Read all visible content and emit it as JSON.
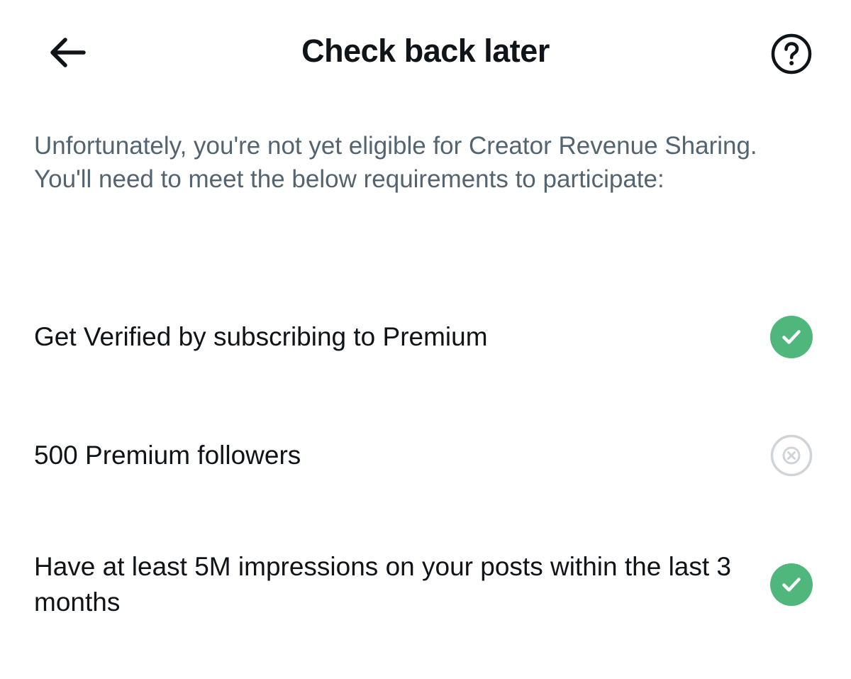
{
  "header": {
    "title": "Check back later",
    "back_icon": "arrow-left-icon",
    "help_icon": "question-circle-icon"
  },
  "intro": {
    "text": "Unfortunately, you're not yet eligible for Creator Revenue Sharing. You'll need to meet the below requirements to participate:"
  },
  "requirements": [
    {
      "label": "Get Verified by subscribing to Premium",
      "status": "met",
      "icon": "check-circle-icon"
    },
    {
      "label": "500 Premium followers",
      "status": "not-met",
      "icon": "x-circle-icon"
    },
    {
      "label": "Have at least 5M impressions on your posts within the last 3 months",
      "status": "met",
      "icon": "check-circle-icon"
    }
  ],
  "colors": {
    "met": "#4fb67c",
    "not_met": "#cfd4d9",
    "text_primary": "#0f1419",
    "text_secondary": "#536471"
  }
}
